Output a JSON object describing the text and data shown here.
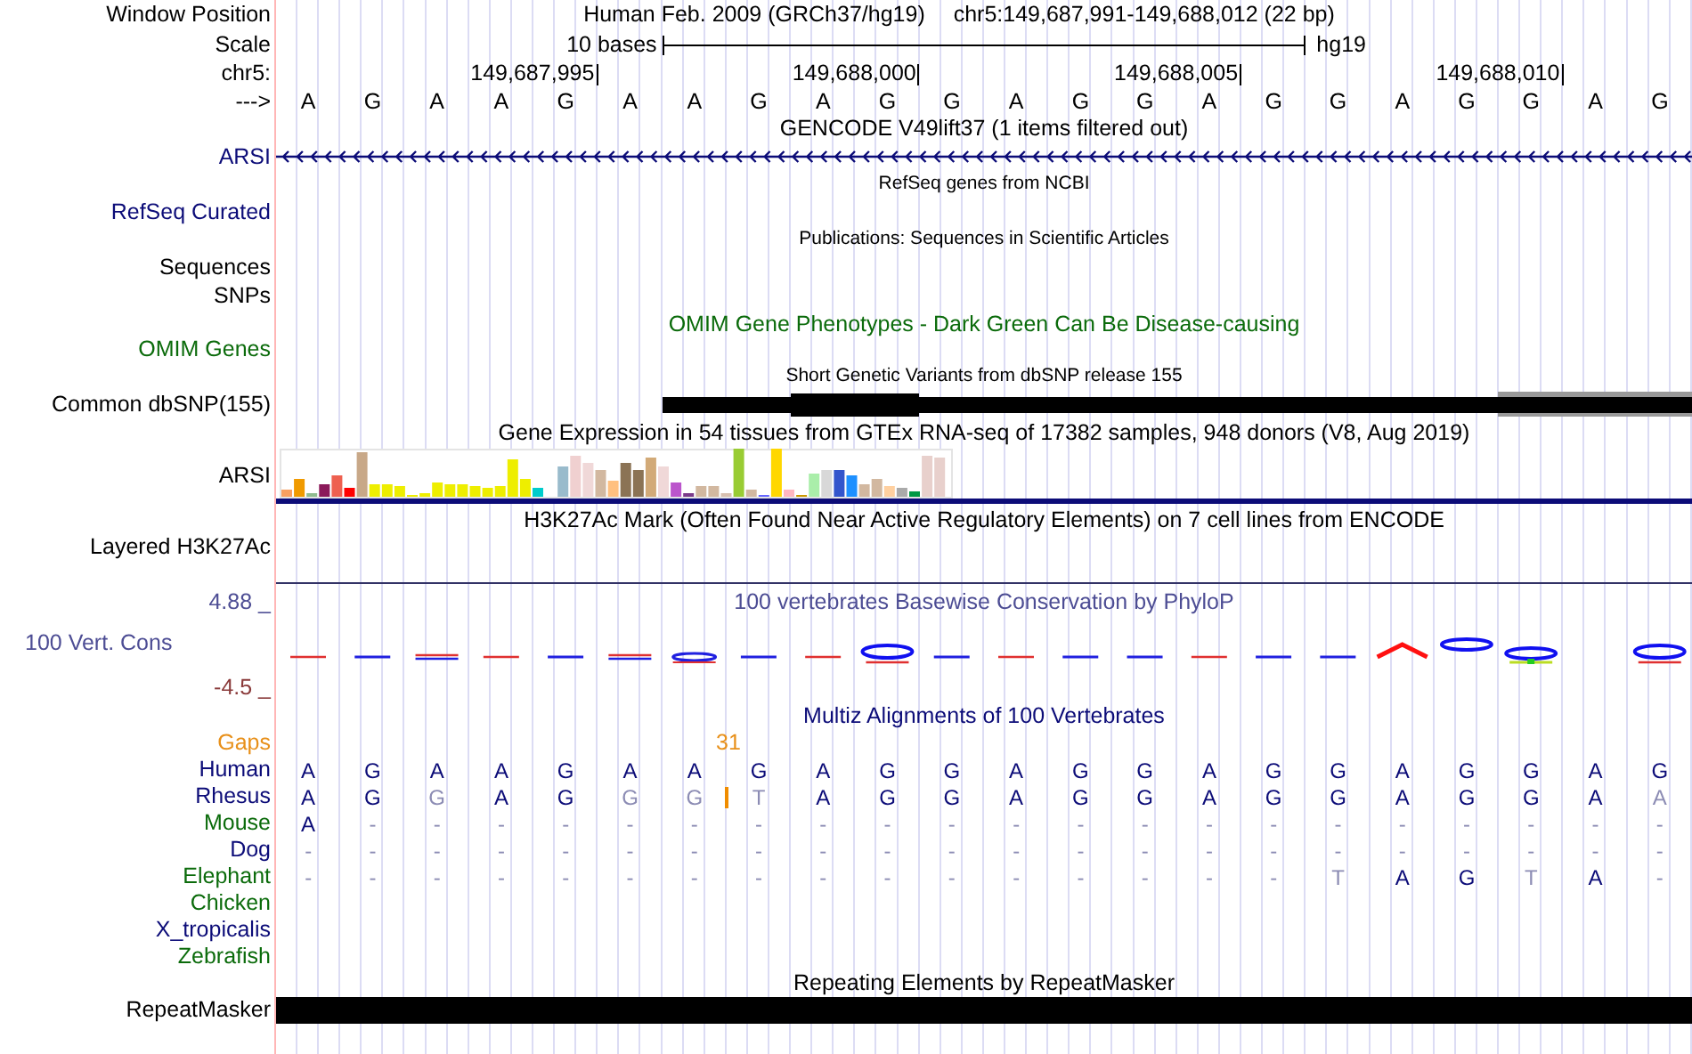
{
  "header": {
    "window_label": "Window Position",
    "assembly": "Human Feb. 2009 (GRCh37/hg19)",
    "position": "chr5:149,687,991-149,688,012 (22 bp)",
    "scale_label": "Scale",
    "scale_text": "10 bases",
    "scale_assembly": "hg19",
    "chrom_label": "chr5:",
    "ticks": [
      "149,687,995",
      "149,688,000",
      "149,688,005",
      "149,688,010"
    ],
    "strand_label": "--->",
    "bases": [
      "A",
      "G",
      "A",
      "A",
      "G",
      "A",
      "A",
      "G",
      "A",
      "G",
      "G",
      "A",
      "G",
      "G",
      "A",
      "G",
      "G",
      "A",
      "G",
      "G",
      "A",
      "G"
    ]
  },
  "tracks": [
    {
      "kind": "gene",
      "title": "GENCODE V49lift37 (1 items filtered out)",
      "label": "ARSI",
      "color": "#0c0c78",
      "reverse_strand": true
    },
    {
      "kind": "names",
      "title": "RefSeq genes from NCBI",
      "labels": [
        "RefSeq Curated"
      ],
      "color": "#0c0c78"
    },
    {
      "kind": "names",
      "title": "Publications: Sequences in Scientific Articles",
      "labels": [
        "Sequences",
        "SNPs"
      ],
      "color": "#000000"
    },
    {
      "kind": "phenotype",
      "title": "OMIM Gene Phenotypes - Dark Green Can Be Disease-causing",
      "label": "OMIM Genes",
      "color": "#0b6b0b"
    },
    {
      "kind": "variants",
      "title": "Short Genetic Variants from dbSNP release 155",
      "label": "Common dbSNP(155)",
      "color": "#000000"
    },
    {
      "kind": "expression",
      "title": "Gene Expression in 54 tissues from GTEx RNA-seq of 17382 samples, 948 donors (V8, Aug 2019)",
      "label": "ARSI",
      "color": "#000000"
    },
    {
      "kind": "layered",
      "title": "H3K27Ac Mark (Often Found Near Active Regulatory Elements) on 7 cell lines from ENCODE",
      "label": "Layered H3K27Ac",
      "color": "#000000"
    },
    {
      "kind": "wiggle",
      "title": "100 vertebrates Basewise Conservation by PhyloP",
      "label": "100 Vert. Cons",
      "ymax": "4.88 _",
      "ymin": "-4.5 _",
      "color": "#4d4d94"
    },
    {
      "kind": "alignment",
      "title": "Multiz Alignments of 100 Vertebrates",
      "gaps_label": "Gaps",
      "color": "#0c0c78",
      "species": [
        {
          "name": "Human",
          "color": "#0c0c78",
          "cells": [
            {
              "base": "A",
              "faded": false
            },
            {
              "base": "G",
              "faded": false
            },
            {
              "base": "A",
              "faded": false
            },
            {
              "base": "A",
              "faded": false
            },
            {
              "base": "G",
              "faded": false
            },
            {
              "base": "A",
              "faded": false
            },
            {
              "base": "A",
              "faded": false
            },
            {
              "base": "G",
              "faded": false
            },
            {
              "base": "A",
              "faded": false
            },
            {
              "base": "G",
              "faded": false
            },
            {
              "base": "G",
              "faded": false
            },
            {
              "base": "A",
              "faded": false
            },
            {
              "base": "G",
              "faded": false
            },
            {
              "base": "G",
              "faded": false
            },
            {
              "base": "A",
              "faded": false
            },
            {
              "base": "G",
              "faded": false
            },
            {
              "base": "G",
              "faded": false
            },
            {
              "base": "A",
              "faded": false
            },
            {
              "base": "G",
              "faded": false
            },
            {
              "base": "G",
              "faded": false
            },
            {
              "base": "A",
              "faded": false
            },
            {
              "base": "G",
              "faded": false
            }
          ]
        },
        {
          "name": "Rhesus",
          "color": "#0c0c78",
          "cells": [
            {
              "base": "A",
              "faded": false
            },
            {
              "base": "G",
              "faded": false
            },
            {
              "base": "G",
              "faded": true
            },
            {
              "base": "A",
              "faded": false
            },
            {
              "base": "G",
              "faded": false
            },
            {
              "base": "G",
              "faded": true
            },
            {
              "base": "G",
              "faded": true,
              "insertion": "31"
            },
            {
              "base": "T",
              "faded": true
            },
            {
              "base": "A",
              "faded": false
            },
            {
              "base": "G",
              "faded": false
            },
            {
              "base": "G",
              "faded": false
            },
            {
              "base": "A",
              "faded": false
            },
            {
              "base": "G",
              "faded": false
            },
            {
              "base": "G",
              "faded": false
            },
            {
              "base": "A",
              "faded": false
            },
            {
              "base": "G",
              "faded": false
            },
            {
              "base": "G",
              "faded": false
            },
            {
              "base": "A",
              "faded": false
            },
            {
              "base": "G",
              "faded": false
            },
            {
              "base": "G",
              "faded": false
            },
            {
              "base": "A",
              "faded": false
            },
            {
              "base": "A",
              "faded": true
            }
          ]
        },
        {
          "name": "Mouse",
          "color": "#0b6b0b",
          "cells": [
            {
              "base": "A",
              "faded": false
            },
            {
              "base": "-",
              "faded": true
            },
            {
              "base": "-",
              "faded": true
            },
            {
              "base": "-",
              "faded": true
            },
            {
              "base": "-",
              "faded": true
            },
            {
              "base": "-",
              "faded": true
            },
            {
              "base": "-",
              "faded": true
            },
            {
              "base": "-",
              "faded": true
            },
            {
              "base": "-",
              "faded": true
            },
            {
              "base": "-",
              "faded": true
            },
            {
              "base": "-",
              "faded": true
            },
            {
              "base": "-",
              "faded": true
            },
            {
              "base": "-",
              "faded": true
            },
            {
              "base": "-",
              "faded": true
            },
            {
              "base": "-",
              "faded": true
            },
            {
              "base": "-",
              "faded": true
            },
            {
              "base": "-",
              "faded": true
            },
            {
              "base": "-",
              "faded": true
            },
            {
              "base": "-",
              "faded": true
            },
            {
              "base": "-",
              "faded": true
            },
            {
              "base": "-",
              "faded": true
            },
            {
              "base": "-",
              "faded": true
            }
          ]
        },
        {
          "name": "Dog",
          "color": "#0c0c78",
          "cells": [
            {
              "base": "-",
              "faded": true
            },
            {
              "base": "-",
              "faded": true
            },
            {
              "base": "-",
              "faded": true
            },
            {
              "base": "-",
              "faded": true
            },
            {
              "base": "-",
              "faded": true
            },
            {
              "base": "-",
              "faded": true
            },
            {
              "base": "-",
              "faded": true
            },
            {
              "base": "-",
              "faded": true
            },
            {
              "base": "-",
              "faded": true
            },
            {
              "base": "-",
              "faded": true
            },
            {
              "base": "-",
              "faded": true
            },
            {
              "base": "-",
              "faded": true
            },
            {
              "base": "-",
              "faded": true
            },
            {
              "base": "-",
              "faded": true
            },
            {
              "base": "-",
              "faded": true
            },
            {
              "base": "-",
              "faded": true
            },
            {
              "base": "-",
              "faded": true
            },
            {
              "base": "-",
              "faded": true
            },
            {
              "base": "-",
              "faded": true
            },
            {
              "base": "-",
              "faded": true
            },
            {
              "base": "-",
              "faded": true
            },
            {
              "base": "-",
              "faded": true
            }
          ]
        },
        {
          "name": "Elephant",
          "color": "#0b6b0b",
          "cells": [
            {
              "base": "-",
              "faded": true
            },
            {
              "base": "-",
              "faded": true
            },
            {
              "base": "-",
              "faded": true
            },
            {
              "base": "-",
              "faded": true
            },
            {
              "base": "-",
              "faded": true
            },
            {
              "base": "-",
              "faded": true
            },
            {
              "base": "-",
              "faded": true
            },
            {
              "base": "-",
              "faded": true
            },
            {
              "base": "-",
              "faded": true
            },
            {
              "base": "-",
              "faded": true
            },
            {
              "base": "-",
              "faded": true
            },
            {
              "base": "-",
              "faded": true
            },
            {
              "base": "-",
              "faded": true
            },
            {
              "base": "-",
              "faded": true
            },
            {
              "base": "-",
              "faded": true
            },
            {
              "base": "-",
              "faded": true
            },
            {
              "base": "T",
              "faded": true
            },
            {
              "base": "A",
              "faded": false
            },
            {
              "base": "G",
              "faded": false
            },
            {
              "base": "T",
              "faded": true
            },
            {
              "base": "A",
              "faded": false
            },
            {
              "base": "-",
              "faded": true
            }
          ]
        },
        {
          "name": "Chicken",
          "color": "#0b6b0b"
        },
        {
          "name": "X_tropicalis",
          "color": "#0c0c78"
        },
        {
          "name": "Zebrafish",
          "color": "#0b6b0b"
        }
      ]
    },
    {
      "kind": "repeats",
      "title": "Repeating Elements by RepeatMasker",
      "label": "RepeatMasker",
      "color": "#000000"
    }
  ]
}
